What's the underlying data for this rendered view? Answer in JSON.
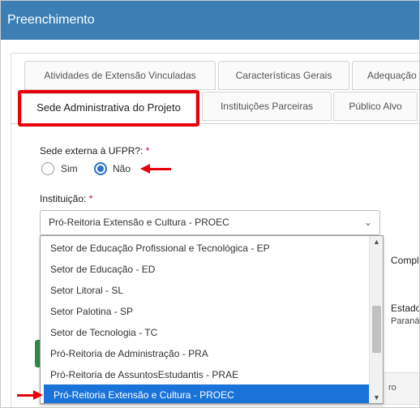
{
  "window": {
    "title": "Preenchimento"
  },
  "tabs": {
    "row1": [
      "Atividades de Extensão Vinculadas",
      "Características Gerais",
      "Adequação"
    ],
    "row2": [
      "Sede Administrativa do Projeto",
      "Instituições Parceiras",
      "Público Alvo"
    ]
  },
  "form": {
    "external_label": "Sede externa à UFPR?:",
    "required_mark": "*",
    "radio_sim": "Sim",
    "radio_nao": "Não",
    "radio_selected": "Não",
    "institution_label": "Instituição:",
    "institution_value": "Pró-Reitoria Extensão e Cultura - PROEC"
  },
  "dropdown": {
    "options": [
      "Setor de Educação Profissional e Tecnológica - EP",
      "Setor de Educação - ED",
      "Setor Litoral - SL",
      "Setor Palotina - SP",
      "Setor de Tecnologia - TC",
      "Pró-Reitoria de Administração - PRA",
      "Pró-Reitoria de AssuntosEstudantis - PRAE",
      "Pró-Reitoria Extensão e Cultura - PROEC"
    ],
    "selected": "Pró-Reitoria Extensão e Cultura - PROEC"
  },
  "partial_text": {
    "complement": "Compl",
    "estado": "Estado",
    "parana": "Paraná",
    "grid_fragment": "ro"
  },
  "colors": {
    "titlebar": "#3c7fb4",
    "highlight": "#e8000b",
    "selected_option": "#1a73d9",
    "radio_accent": "#2a73c7"
  }
}
